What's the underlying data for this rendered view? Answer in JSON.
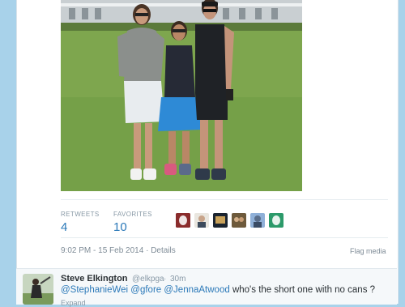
{
  "tweet": {
    "stats": {
      "retweets_label": "RETWEETS",
      "retweets_count": "4",
      "favorites_label": "FAVORITES",
      "favorites_count": "10"
    },
    "favoriter_avatars": [
      "avatar-1",
      "avatar-2",
      "avatar-3",
      "avatar-4",
      "avatar-5",
      "avatar-6"
    ],
    "timestamp": "9:02 PM - 15 Feb 2014",
    "details_link": "Details",
    "flag_link": "Flag media"
  },
  "reply": {
    "name": "Steve Elkington",
    "handle": "@elkpga",
    "time": "30m",
    "mention_1": "@StephanieWei",
    "mention_2": "@gfore",
    "mention_3": "@JennaAtwood",
    "text": "who's the short one with no cans ?",
    "expand_label": "Expand"
  },
  "colors": {
    "page_background": "#a8d2ea",
    "link_blue": "#2a78b8",
    "muted_text": "#8899a6"
  }
}
